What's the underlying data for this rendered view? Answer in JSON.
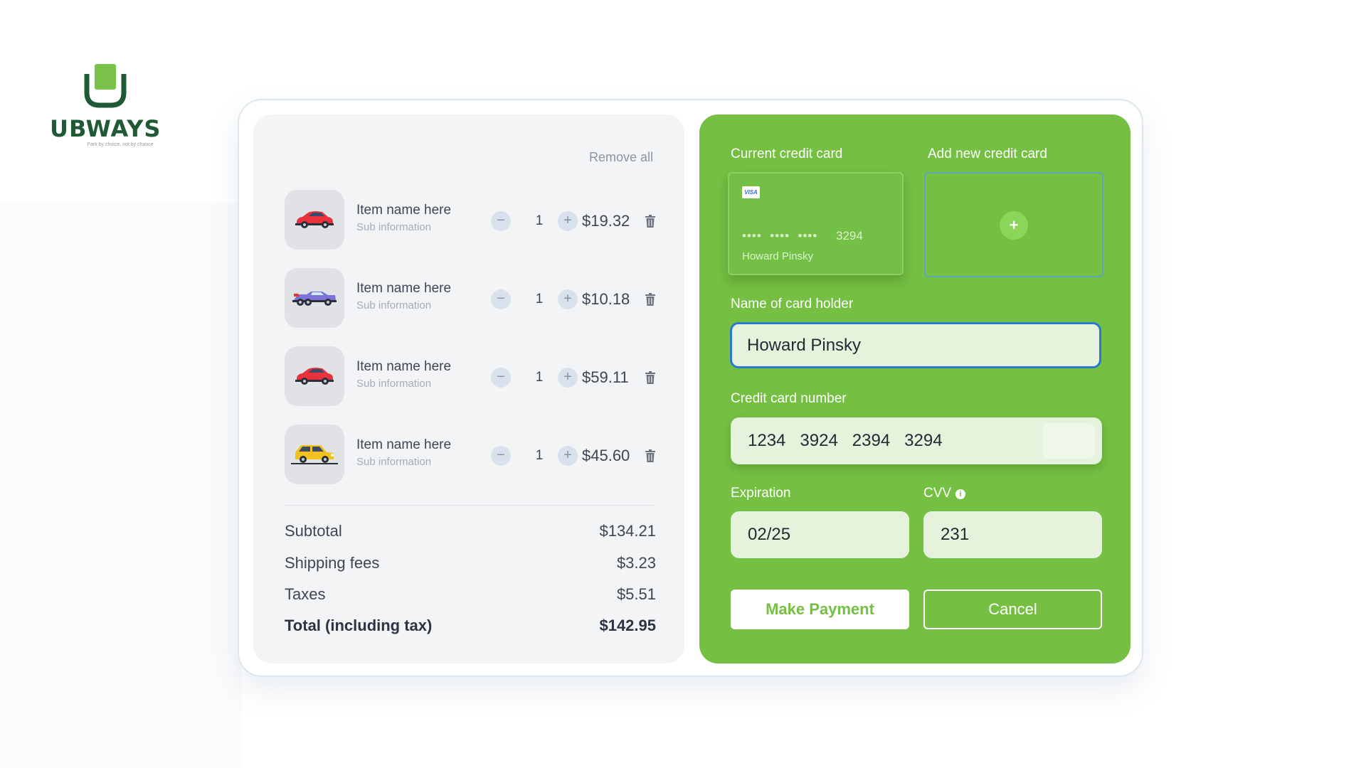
{
  "brand": {
    "name": "UBWAYS",
    "tagline": "Park by choice, not by chance",
    "primary_color": "#75bf43",
    "logo_color": "#1f5a34"
  },
  "cart": {
    "remove_all_label": "Remove all",
    "items": [
      {
        "name": "Item name here",
        "sub": "Sub information",
        "qty": "1",
        "price": "$19.32",
        "icon": "red-car-icon"
      },
      {
        "name": "Item name here",
        "sub": "Sub information",
        "qty": "1",
        "price": "$10.18",
        "icon": "race-car-icon"
      },
      {
        "name": "Item name here",
        "sub": "Sub information",
        "qty": "1",
        "price": "$59.11",
        "icon": "red-car-icon"
      },
      {
        "name": "Item name here",
        "sub": "Sub information",
        "qty": "1",
        "price": "$45.60",
        "icon": "yellow-car-icon"
      }
    ],
    "decrement_symbol": "−",
    "increment_symbol": "+",
    "summary": {
      "subtotal_label": "Subtotal",
      "subtotal_value": "$134.21",
      "shipping_label": "Shipping fees",
      "shipping_value": "$3.23",
      "taxes_label": "Taxes",
      "taxes_value": "$5.51",
      "total_label": "Total (including tax)",
      "total_value": "$142.95"
    }
  },
  "payment": {
    "current_card_label": "Current credit card",
    "add_card_label": "Add new credit card",
    "add_card_symbol": "+",
    "current_card": {
      "brand": "VISA",
      "masked": "••••  ••••  ••••",
      "last4": "3294",
      "holder": "Howard Pinsky"
    },
    "holder_label": "Name of card holder",
    "holder_value": "Howard Pinsky",
    "number_label": "Credit card number",
    "number_value": "1234   3924   2394   3294",
    "expiration_label": "Expiration",
    "expiration_value": "02/25",
    "cvv_label": "CVV",
    "cvv_info_symbol": "i",
    "cvv_value": "231",
    "pay_button": "Make Payment",
    "cancel_button": "Cancel"
  }
}
